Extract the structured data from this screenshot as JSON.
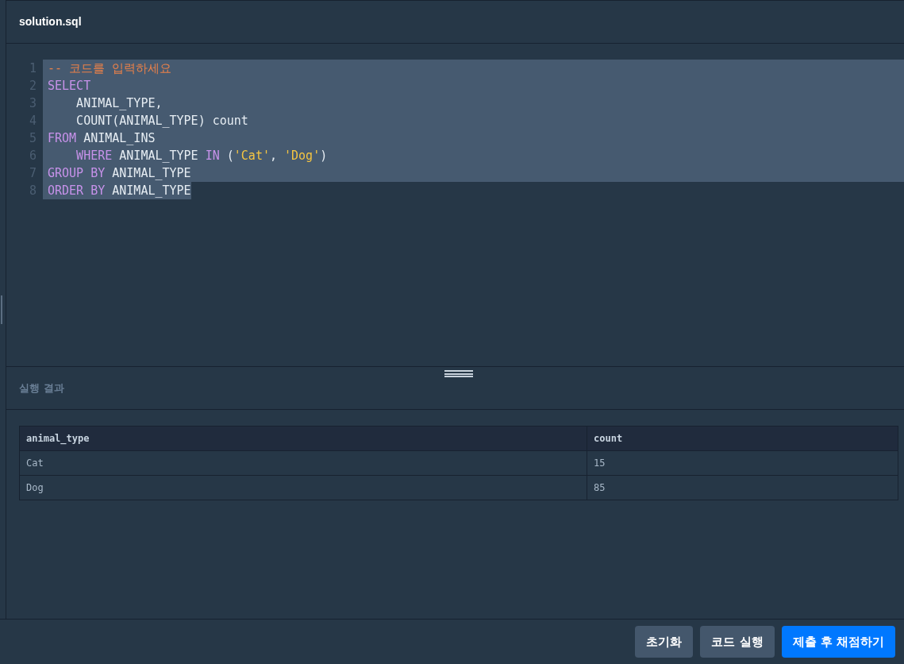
{
  "editor": {
    "filename": "solution.sql",
    "lines": [
      {
        "number": "1",
        "selected": true,
        "indented": false,
        "tokens": [
          {
            "kind": "comment",
            "text": "-- 코드를 입력하세요"
          }
        ]
      },
      {
        "number": "2",
        "selected": true,
        "indented": false,
        "tokens": [
          {
            "kind": "keyword",
            "text": "SELECT"
          }
        ]
      },
      {
        "number": "3",
        "selected": true,
        "indented": true,
        "tokens": [
          {
            "kind": "plain",
            "text": "ANIMAL_TYPE,"
          }
        ]
      },
      {
        "number": "4",
        "selected": true,
        "indented": true,
        "tokens": [
          {
            "kind": "plain",
            "text": "COUNT(ANIMAL_TYPE) count"
          }
        ]
      },
      {
        "number": "5",
        "selected": true,
        "indented": false,
        "tokens": [
          {
            "kind": "keyword",
            "text": "FROM"
          },
          {
            "kind": "plain",
            "text": " ANIMAL_INS"
          }
        ]
      },
      {
        "number": "6",
        "selected": true,
        "indented": true,
        "tokens": [
          {
            "kind": "keyword",
            "text": "WHERE"
          },
          {
            "kind": "plain",
            "text": " ANIMAL_TYPE "
          },
          {
            "kind": "keyword",
            "text": "IN"
          },
          {
            "kind": "plain",
            "text": " ("
          },
          {
            "kind": "string",
            "text": "'Cat'"
          },
          {
            "kind": "plain",
            "text": ", "
          },
          {
            "kind": "string",
            "text": "'Dog'"
          },
          {
            "kind": "plain",
            "text": ")"
          }
        ]
      },
      {
        "number": "7",
        "selected": true,
        "indented": false,
        "tokens": [
          {
            "kind": "keyword",
            "text": "GROUP BY"
          },
          {
            "kind": "plain",
            "text": " ANIMAL_TYPE"
          }
        ]
      },
      {
        "number": "8",
        "selected": true,
        "indented": false,
        "tokens": [
          {
            "kind": "keyword",
            "text": "ORDER BY"
          },
          {
            "kind": "plain",
            "text": " ANIMAL_TYPE"
          }
        ]
      }
    ]
  },
  "results": {
    "title": "실행 결과",
    "table": {
      "columns": [
        "animal_type",
        "count"
      ],
      "rows": [
        [
          "Cat",
          "15"
        ],
        [
          "Dog",
          "85"
        ]
      ]
    }
  },
  "buttons": [
    {
      "label": "초기화",
      "kind": "secondary"
    },
    {
      "label": "코드 실행",
      "kind": "secondary"
    },
    {
      "label": "제출 후 채점하기",
      "kind": "primary"
    }
  ]
}
